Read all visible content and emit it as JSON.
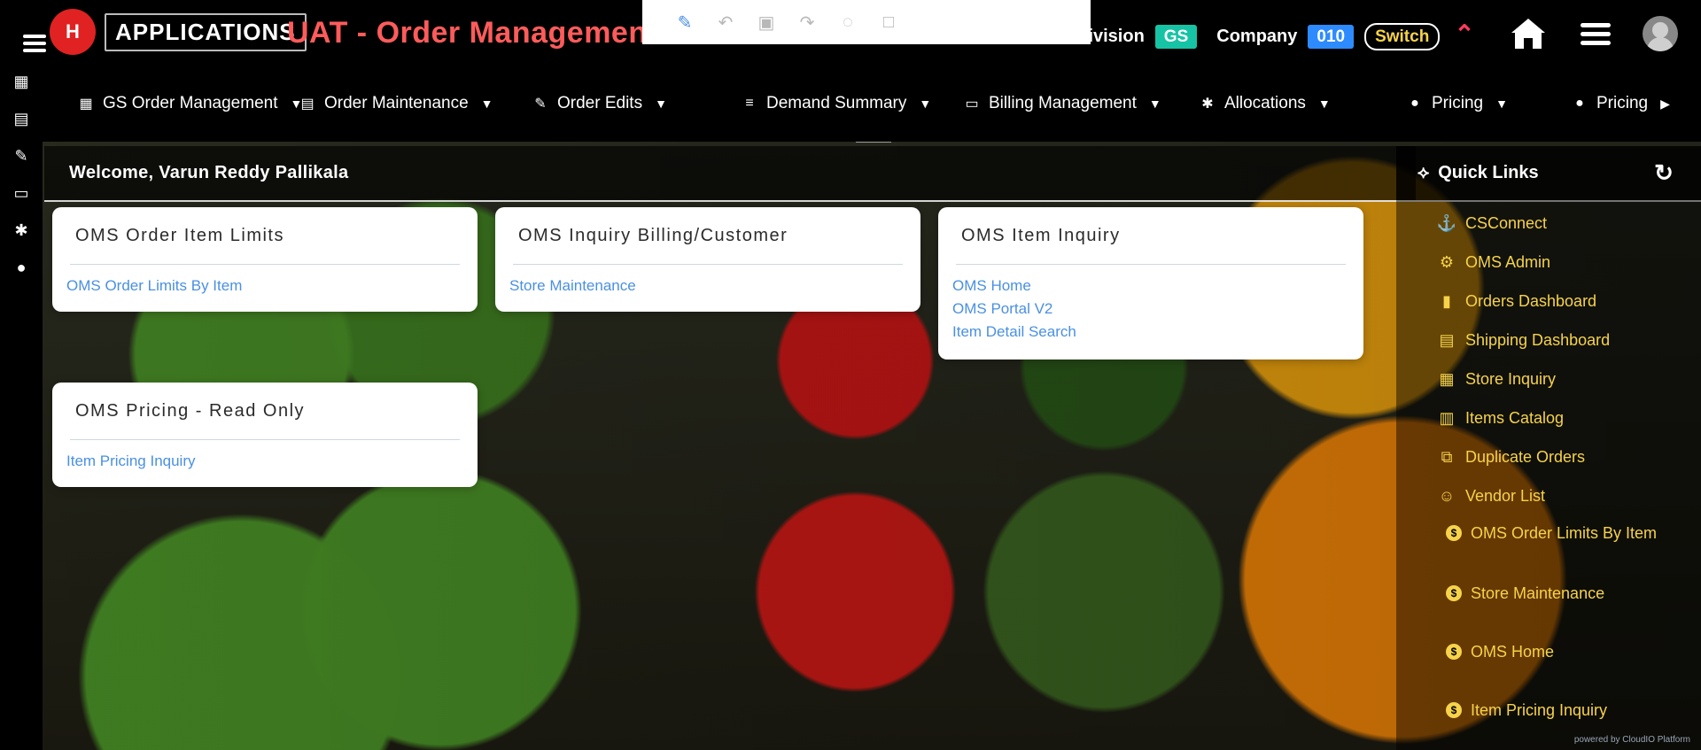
{
  "colors": {
    "title_red": "#ff5b5b",
    "link_blue": "#4a90e2",
    "quicklink_yellow": "#f6d34a",
    "division_green": "#17c3a5",
    "company_blue": "#2d8bff",
    "up_red": "#ff3b5c"
  },
  "header": {
    "brand_text": "APPLICATIONS",
    "title": "UAT - Order Managemen",
    "division_label": "Division",
    "division_value": "GS",
    "company_label": "Company",
    "company_value": "010",
    "switch_label": "Switch",
    "icons": [
      "menu-icon",
      "double-chevron-up-icon",
      "home-icon",
      "hamburger-icon",
      "user-avatar-icon"
    ]
  },
  "toolbar_icons": [
    {
      "name": "edit-icon",
      "active": true
    },
    {
      "name": "undo-icon",
      "active": false
    },
    {
      "name": "save-icon",
      "active": false
    },
    {
      "name": "redo-icon",
      "active": false
    },
    {
      "name": "eye-slash-icon",
      "active": false
    },
    {
      "name": "expand-icon",
      "active": false
    }
  ],
  "nav": {
    "items": [
      {
        "label": "GS Order Management",
        "icon": "grid-icon",
        "has_caret": true
      },
      {
        "label": "Order Maintenance",
        "icon": "list-icon",
        "has_caret": true
      },
      {
        "label": "Order Edits",
        "icon": "edit-icon",
        "has_caret": true
      },
      {
        "label": "Demand Summary",
        "icon": "bars-icon",
        "has_caret": true
      },
      {
        "label": "Billing Management",
        "icon": "card-icon",
        "has_caret": true
      },
      {
        "label": "Allocations",
        "icon": "asterisk-icon",
        "has_caret": true
      },
      {
        "label": "Pricing",
        "icon": "dollar-coin-icon",
        "has_caret": true
      },
      {
        "label": "Pricing",
        "icon": "dollar-coin-icon",
        "has_caret": false,
        "has_right_arrow": true
      }
    ]
  },
  "welcome": {
    "text": "Welcome, Varun Reddy Pallikala"
  },
  "cards": [
    {
      "title": "OMS Order Item Limits",
      "links": [
        "OMS Order Limits By Item"
      ]
    },
    {
      "title": "OMS Inquiry Billing/Customer",
      "links": [
        "Store Maintenance"
      ]
    },
    {
      "title": "OMS Item Inquiry",
      "links": [
        "OMS Home",
        "OMS Portal V2",
        "Item Detail Search"
      ]
    },
    {
      "title": "OMS Pricing - Read Only",
      "links": [
        "Item Pricing Inquiry"
      ]
    }
  ],
  "quick_links": {
    "title": "Quick Links",
    "items": [
      {
        "label": "CSConnect",
        "icon": "anchor-icon"
      },
      {
        "label": "OMS Admin",
        "icon": "gear-icon"
      },
      {
        "label": "Orders Dashboard",
        "icon": "bar-chart-icon"
      },
      {
        "label": "Shipping Dashboard",
        "icon": "clipboard-icon"
      },
      {
        "label": "Store Inquiry",
        "icon": "store-icon"
      },
      {
        "label": "Items Catalog",
        "icon": "books-icon"
      },
      {
        "label": "Duplicate Orders",
        "icon": "copy-icon"
      },
      {
        "label": "Vendor List",
        "icon": "users-icon"
      },
      {
        "label": "OMS Order Limits By Item",
        "icon": "dollar-coin-icon"
      },
      {
        "label": "Store Maintenance",
        "icon": "dollar-coin-icon"
      },
      {
        "label": "OMS Home",
        "icon": "dollar-coin-icon"
      },
      {
        "label": "Item Pricing Inquiry",
        "icon": "dollar-coin-icon"
      }
    ]
  },
  "footer": {
    "text": "powered by CloudIO Platform"
  }
}
